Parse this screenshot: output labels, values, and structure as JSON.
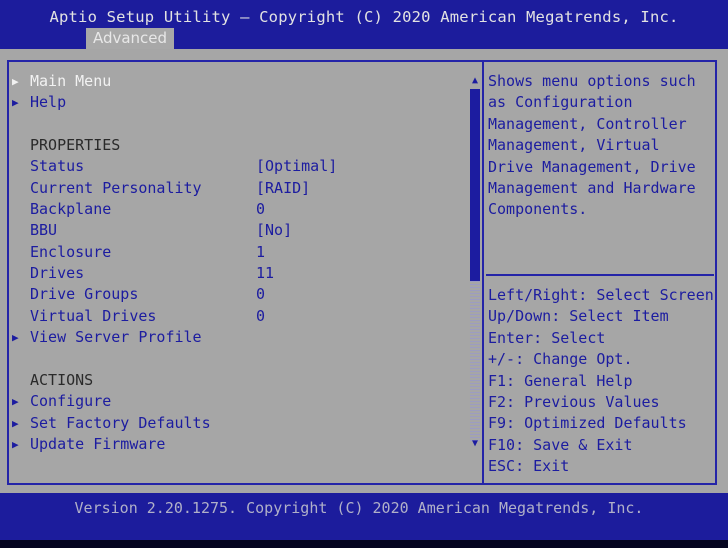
{
  "header": {
    "title": "Aptio Setup Utility – Copyright (C) 2020 American Megatrends, Inc.",
    "active_tab": "Advanced"
  },
  "menu": {
    "top_items": [
      {
        "label": "Main Menu",
        "selected": true
      },
      {
        "label": "Help",
        "selected": false
      }
    ],
    "properties_heading": "PROPERTIES",
    "properties": [
      {
        "label": "Status",
        "value": "[Optimal]"
      },
      {
        "label": "Current Personality",
        "value": "[RAID]"
      },
      {
        "label": "Backplane",
        "value": "0"
      },
      {
        "label": "BBU",
        "value": "[No]"
      },
      {
        "label": "Enclosure",
        "value": "1"
      },
      {
        "label": "Drives",
        "value": "11"
      },
      {
        "label": "Drive Groups",
        "value": "0"
      },
      {
        "label": "Virtual Drives",
        "value": "0"
      }
    ],
    "view_server_profile": "View Server Profile",
    "actions_heading": "ACTIONS",
    "actions": [
      {
        "label": "Configure"
      },
      {
        "label": "Set Factory Defaults"
      },
      {
        "label": "Update Firmware"
      }
    ]
  },
  "help_panel": {
    "description": "Shows menu options such\nas Configuration\nManagement, Controller\nManagement, Virtual\nDrive Management, Drive\nManagement and Hardware\nComponents.",
    "keys": [
      "Left/Right: Select Screen",
      "Up/Down: Select Item",
      "Enter: Select",
      "+/-: Change Opt.",
      "F1: General Help",
      "F2: Previous Values",
      "F9: Optimized Defaults",
      "F10: Save & Exit",
      "ESC: Exit"
    ]
  },
  "footer": {
    "version": "Version 2.20.1275. Copyright (C) 2020 American Megatrends, Inc."
  },
  "icons": {
    "submenu_arrow": "▶",
    "scroll_up": "▲",
    "scroll_down": "▼"
  },
  "colors": {
    "header_bg": "#1c1c9c",
    "panel_bg": "#a6a6a6",
    "text_blue": "#1c1ca0",
    "selected_text": "#f2f2f2"
  }
}
